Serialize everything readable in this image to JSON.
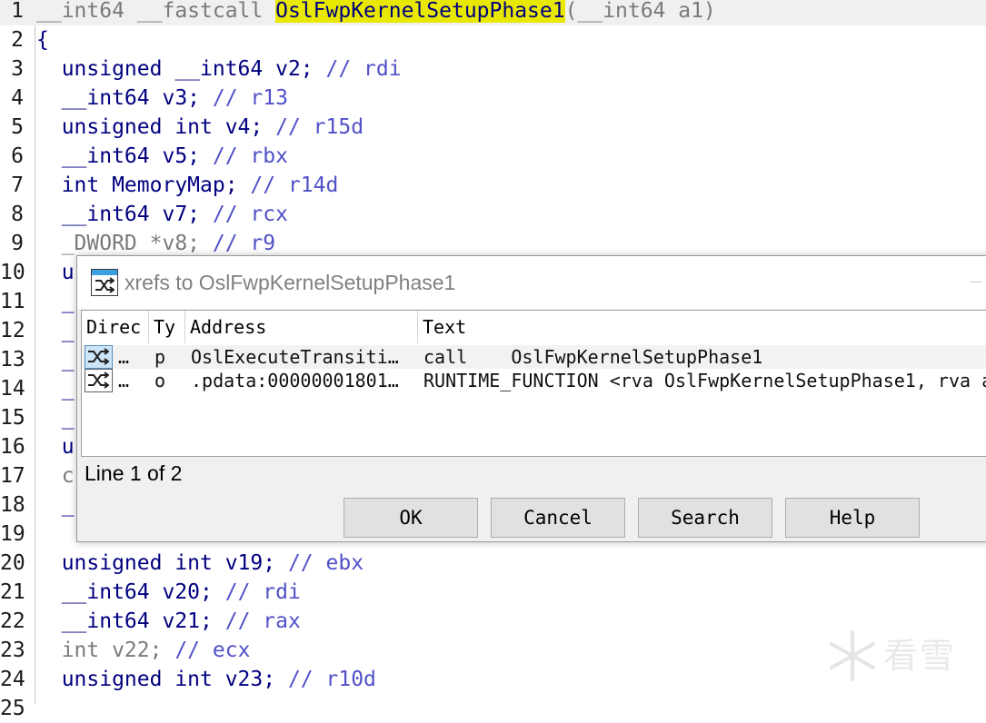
{
  "code": {
    "lines": [
      {
        "num": "1",
        "segments": [
          {
            "c": "dim",
            "t": "__int64 __fastcall "
          },
          {
            "c": "hl",
            "t": "OslFwpKernelSetupPhase1"
          },
          {
            "c": "dim",
            "t": "(__int64 a1)"
          }
        ]
      },
      {
        "num": "2",
        "segments": [
          {
            "c": "pl",
            "t": "{"
          }
        ]
      },
      {
        "num": "3",
        "segments": [
          {
            "c": "pl",
            "t": "  unsigned __int64 v2; "
          },
          {
            "c": "cm",
            "t": "// rdi"
          }
        ]
      },
      {
        "num": "4",
        "segments": [
          {
            "c": "pl",
            "t": "  __int64 v3; "
          },
          {
            "c": "cm",
            "t": "// r13"
          }
        ]
      },
      {
        "num": "5",
        "segments": [
          {
            "c": "pl",
            "t": "  unsigned int v4; "
          },
          {
            "c": "cm",
            "t": "// r15d"
          }
        ]
      },
      {
        "num": "6",
        "segments": [
          {
            "c": "pl",
            "t": "  __int64 v5; "
          },
          {
            "c": "cm",
            "t": "// rbx"
          }
        ]
      },
      {
        "num": "7",
        "segments": [
          {
            "c": "pl",
            "t": "  int MemoryMap; "
          },
          {
            "c": "cm",
            "t": "// r14d"
          }
        ]
      },
      {
        "num": "8",
        "segments": [
          {
            "c": "pl",
            "t": "  __int64 v7; "
          },
          {
            "c": "cm",
            "t": "// rcx"
          }
        ]
      },
      {
        "num": "9",
        "segments": [
          {
            "c": "dim",
            "t": "  _DWORD *v8; "
          },
          {
            "c": "cm",
            "t": "// r9"
          }
        ]
      },
      {
        "num": "10",
        "segments": [
          {
            "c": "pl",
            "t": "  u"
          }
        ]
      },
      {
        "num": "11",
        "segments": [
          {
            "c": "pl",
            "t": "  _"
          }
        ]
      },
      {
        "num": "12",
        "segments": [
          {
            "c": "pl",
            "t": "  _"
          }
        ]
      },
      {
        "num": "13",
        "segments": [
          {
            "c": "pl",
            "t": "  _"
          }
        ]
      },
      {
        "num": "14",
        "segments": [
          {
            "c": "pl",
            "t": "  _"
          }
        ]
      },
      {
        "num": "15",
        "segments": [
          {
            "c": "pl",
            "t": "  _"
          }
        ]
      },
      {
        "num": "16",
        "segments": [
          {
            "c": "pl",
            "t": "  u"
          }
        ]
      },
      {
        "num": "17",
        "segments": [
          {
            "c": "dim",
            "t": "  c"
          }
        ]
      },
      {
        "num": "18",
        "segments": [
          {
            "c": "pl",
            "t": "  _"
          }
        ]
      },
      {
        "num": "19",
        "segments": [
          {
            "c": "pl",
            "t": ""
          }
        ]
      },
      {
        "num": "20",
        "segments": [
          {
            "c": "pl",
            "t": "  unsigned int v19; "
          },
          {
            "c": "cm",
            "t": "// ebx"
          }
        ]
      },
      {
        "num": "21",
        "segments": [
          {
            "c": "pl",
            "t": "  __int64 v20; "
          },
          {
            "c": "cm",
            "t": "// rdi"
          }
        ]
      },
      {
        "num": "22",
        "segments": [
          {
            "c": "pl",
            "t": "  __int64 v21; "
          },
          {
            "c": "cm",
            "t": "// rax"
          }
        ]
      },
      {
        "num": "23",
        "segments": [
          {
            "c": "dim",
            "t": "  int v22; "
          },
          {
            "c": "cm",
            "t": "// ecx"
          }
        ]
      },
      {
        "num": "24",
        "segments": [
          {
            "c": "pl",
            "t": "  unsigned int v23; "
          },
          {
            "c": "cm",
            "t": "// r10d"
          }
        ]
      },
      {
        "num": "25",
        "segments": [
          {
            "c": "pl",
            "t": ""
          }
        ]
      }
    ]
  },
  "dialog": {
    "title": "xrefs to OslFwpKernelSetupPhase1",
    "columns": [
      "Direc",
      "Ty",
      "Address",
      "Text"
    ],
    "rows": [
      {
        "direction": "…",
        "type": "p",
        "address": "OslExecuteTransiti…",
        "text": "call    OslFwpKernelSetupPhase1",
        "selected": true
      },
      {
        "direction": "…",
        "type": "o",
        "address": ".pdata:00000001801…",
        "text": "RUNTIME_FUNCTION <rva OslFwpKernelSetupPhase1, rva a",
        "selected": false
      }
    ],
    "status": "Line 1 of 2",
    "buttons": {
      "ok": "OK",
      "cancel": "Cancel",
      "search": "Search",
      "help": "Help"
    }
  },
  "watermark": {
    "text": "看雪"
  },
  "icons": {
    "title": "xref-icon",
    "row": "xref-icon",
    "watermark": "snowflake-icon"
  },
  "colors": {
    "highlight": "#e8e800",
    "code": "#000080",
    "comment": "#5050c8",
    "selection": "#cce4f7"
  }
}
